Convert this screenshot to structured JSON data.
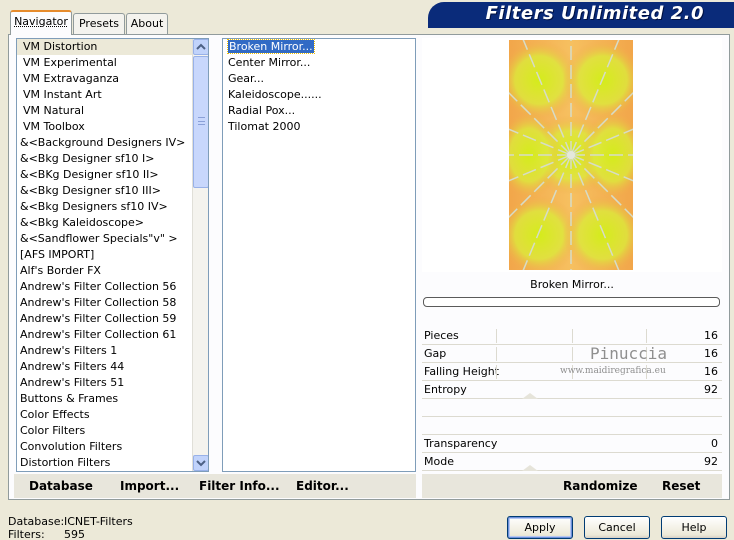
{
  "tabs": [
    {
      "label": "Navigator",
      "active": true
    },
    {
      "label": "Presets",
      "active": false
    },
    {
      "label": "About",
      "active": false
    }
  ],
  "banner": {
    "title": "Filters Unlimited 2.0"
  },
  "categories": [
    "VM Distortion",
    "VM Experimental",
    "VM Extravaganza",
    "VM Instant Art",
    "VM Natural",
    "VM Toolbox",
    "&<Background Designers IV>",
    "&<Bkg Designer sf10 I>",
    "&<BKg Designer sf10 II>",
    "&<Bkg Designer sf10 III>",
    "&<Bkg Designers sf10 IV>",
    "&<Bkg Kaleidoscope>",
    "&<Sandflower Specials\"v\" >",
    "[AFS IMPORT]",
    "Alf's Border FX",
    "Andrew's Filter Collection 56",
    "Andrew's Filter Collection 58",
    "Andrew's Filter Collection 59",
    "Andrew's Filter Collection 61",
    "Andrew's Filters 1",
    "Andrew's Filters 44",
    "Andrew's Filters 51",
    "Buttons & Frames",
    "Color Effects",
    "Color Filters",
    "Convolution Filters",
    "Distortion Filters"
  ],
  "selected_category": "VM Distortion",
  "filters": [
    "Broken Mirror...",
    "Center Mirror...",
    "Gear...",
    "Kaleidoscope......",
    "Radial Pox...",
    "Tilomat 2000"
  ],
  "selected_filter": "Broken Mirror...",
  "preview": {
    "filter_name": "Broken Mirror..."
  },
  "params": [
    {
      "name": "Pieces",
      "value": "16"
    },
    {
      "name": "Gap",
      "value": "16"
    },
    {
      "name": "Falling Height",
      "value": "16"
    },
    {
      "name": "Entropy",
      "value": "92"
    },
    {
      "name": "",
      "value": ""
    },
    {
      "name": "",
      "value": ""
    },
    {
      "name": "Transparency",
      "value": "0"
    },
    {
      "name": "Mode",
      "value": "92"
    }
  ],
  "watermark": {
    "name": "Pinuccia",
    "url": "www.maidiregrafica.eu"
  },
  "toolbar": {
    "database": "Database",
    "import": "Import...",
    "filter_info": "Filter Info...",
    "editor": "Editor...",
    "randomize": "Randomize",
    "reset": "Reset"
  },
  "status": {
    "database_label": "Database:",
    "database_value": "ICNET-Filters",
    "filters_label": "Filters:",
    "filters_value": "595"
  },
  "buttons": {
    "apply": "Apply",
    "cancel": "Cancel",
    "help": "Help"
  },
  "colors": {
    "banner": "#0a2b7a",
    "selection": "#316ac5",
    "preview_green": "#d4ec1a",
    "preview_orange": "#f2a64a"
  }
}
